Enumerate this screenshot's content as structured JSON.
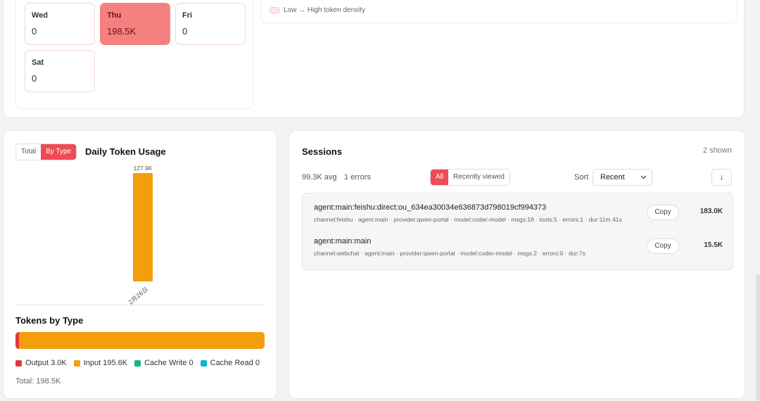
{
  "weekday": {
    "cells": [
      {
        "name": "Wed",
        "value": "0",
        "hot": false
      },
      {
        "name": "Thu",
        "value": "198.5K",
        "hot": true
      },
      {
        "name": "Fri",
        "value": "0",
        "hot": false
      },
      {
        "name": "Sat",
        "value": "0",
        "hot": false
      }
    ],
    "legend": "Low → High token density"
  },
  "usage": {
    "toggle_total": "Total",
    "toggle_by_type": "By Type",
    "title": "Daily Token Usage",
    "tokens_by_type_title": "Tokens by Type",
    "legend": [
      {
        "label": "Output 3.0K",
        "color": "#e5373f"
      },
      {
        "label": "Input 195.6K",
        "color": "#f59e0b"
      },
      {
        "label": "Cache Write 0",
        "color": "#10b981"
      },
      {
        "label": "Cache Read 0",
        "color": "#06b6d4"
      }
    ],
    "total": "Total: 198.5K",
    "type_shares": {
      "output": 3.0,
      "input": 195.6,
      "cache_write": 0,
      "cache_read": 0
    }
  },
  "chart_data": {
    "type": "bar",
    "categories": [
      "2月26日"
    ],
    "values": [
      127.9
    ],
    "value_labels": [
      "127.9K"
    ],
    "title": "Daily Token Usage",
    "xlabel": "",
    "ylabel": "",
    "ylim": [
      0,
      127.9
    ],
    "color": "#f59e0b"
  },
  "sessions": {
    "title": "Sessions",
    "shown": "2 shown",
    "avg": "99.3K avg",
    "errors": "1 errors",
    "filter_all": "All",
    "filter_recent": "Recently viewed",
    "sort_label": "Sort",
    "sort_value": "Recent",
    "direction_icon": "↓",
    "copy_label": "Copy",
    "rows": [
      {
        "name": "agent:main:feishu:direct:ou_634ea30034e636873d798019cf994373",
        "meta": "channel:feishu · agent:main · provider:qwen-portal · model:coder-model · msgs:18 · tools:5 · errors:1 · dur:11m 41s",
        "tokens": "183.0K"
      },
      {
        "name": "agent:main:main",
        "meta": "channel:webchat · agent:main · provider:qwen-portal · model:coder-model · msgs:2 · errors:0 · dur:7s",
        "tokens": "15.5K"
      }
    ]
  }
}
